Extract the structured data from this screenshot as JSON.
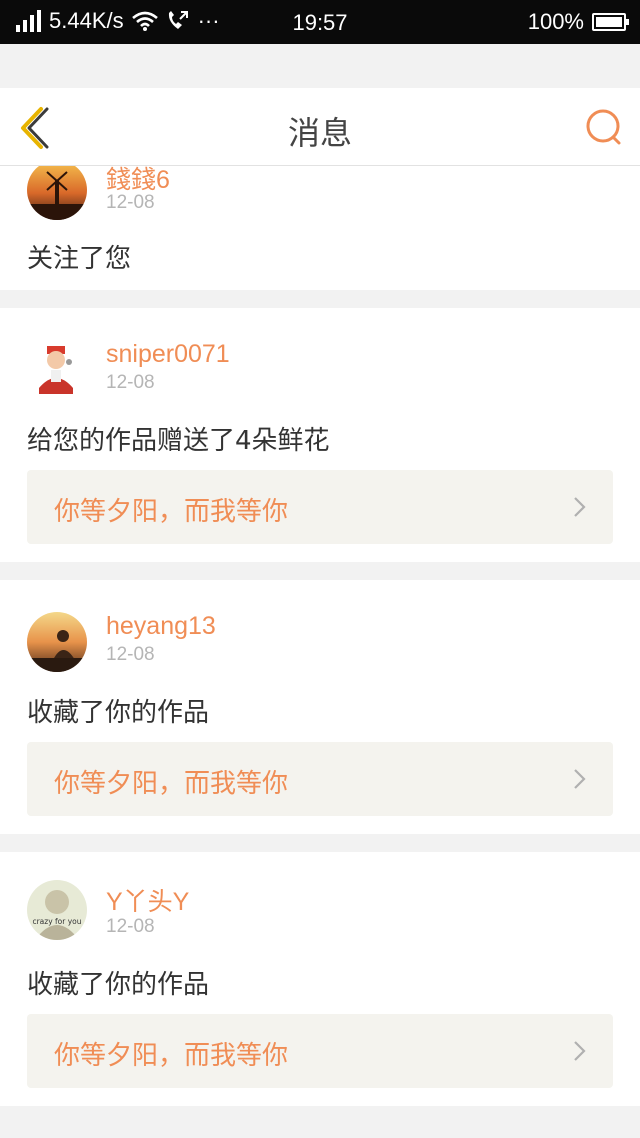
{
  "status_bar": {
    "network_speed": "5.44K/s",
    "extra": "···",
    "time": "19:57",
    "battery": "100%"
  },
  "nav": {
    "title": "消息",
    "back_icon": "chevron-left-icon",
    "search_icon": "search-icon"
  },
  "colors": {
    "accent": "#f08d55",
    "nav_icon_back": "#e8b400",
    "card_bg": "#ffffff",
    "page_bg": "#f2f2f2",
    "work_bg": "#f4f3ee"
  },
  "messages": [
    {
      "username": "錢錢6",
      "date": "12-08",
      "action": "关注了您",
      "work_title": null
    },
    {
      "username": "sniper0071",
      "date": "12-08",
      "action": "给您的作品赠送了4朵鲜花",
      "work_title": "你等夕阳，而我等你"
    },
    {
      "username": "heyang13",
      "date": "12-08",
      "action": "收藏了你的作品",
      "work_title": "你等夕阳，而我等你"
    },
    {
      "username": "Y丫头Y",
      "date": "12-08",
      "action": "收藏了你的作品",
      "work_title": "你等夕阳，而我等你",
      "avatar_text": "crazy for you"
    }
  ]
}
